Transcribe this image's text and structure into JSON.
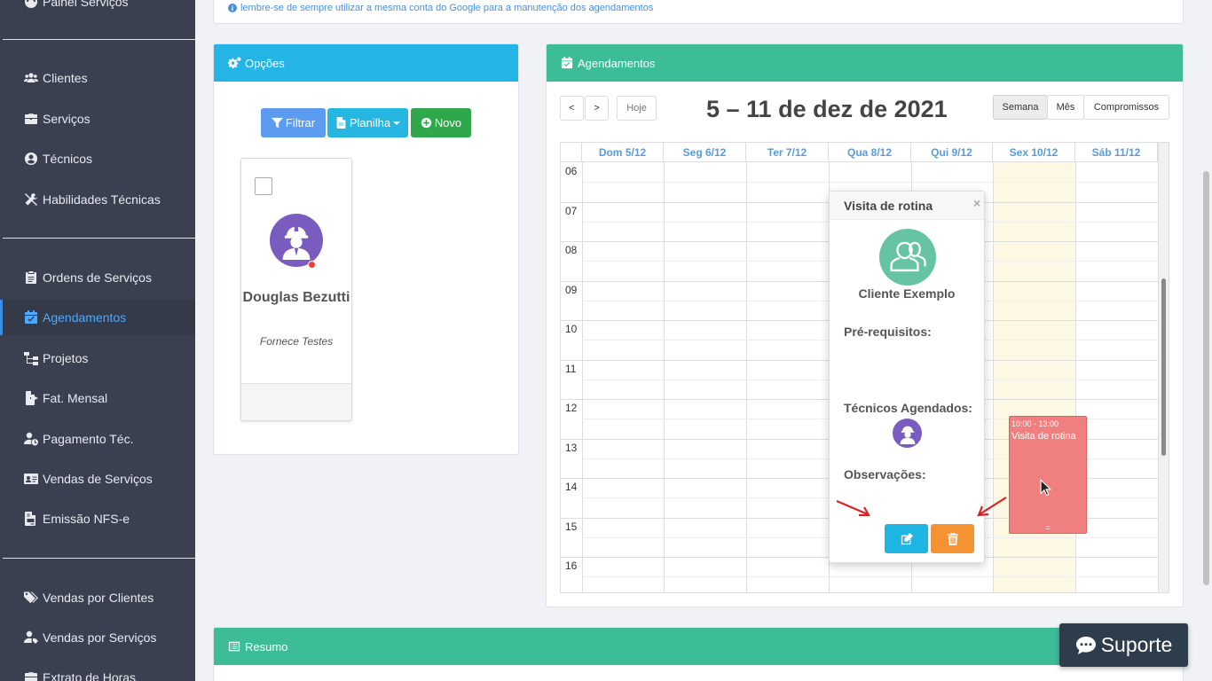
{
  "sidebar": {
    "items": [
      {
        "label": "Painel Serviços",
        "icon": "dashboard-icon"
      },
      {
        "label": "Clientes",
        "icon": "users-icon"
      },
      {
        "label": "Serviços",
        "icon": "briefcase-icon"
      },
      {
        "label": "Técnicos",
        "icon": "user-circle-icon"
      },
      {
        "label": "Habilidades Técnicas",
        "icon": "tools-icon"
      },
      {
        "label": "Ordens de Serviços",
        "icon": "clipboard-icon"
      },
      {
        "label": "Agendamentos",
        "icon": "calendar-check-icon"
      },
      {
        "label": "Projetos",
        "icon": "sitemap-icon"
      },
      {
        "label": "Fat. Mensal",
        "icon": "file-export-icon"
      },
      {
        "label": "Pagamento Téc.",
        "icon": "user-clock-icon"
      },
      {
        "label": "Vendas de Serviços",
        "icon": "id-card-icon"
      },
      {
        "label": "Emissão NFS-e",
        "icon": "file-invoice-icon"
      },
      {
        "label": "Vendas por Clientes",
        "icon": "tags-icon"
      },
      {
        "label": "Vendas por Serviços",
        "icon": "user-tag-icon"
      },
      {
        "label": "Extrato de Horas",
        "icon": "briefcase-clock-icon"
      }
    ],
    "active": "Agendamentos"
  },
  "top_note": "lembre-se de sempre utilizar a mesma conta do Google para a manutenção dos agendamentos",
  "options_panel": {
    "title": "Opções",
    "filter_label": "Filtrar",
    "sheet_label": "Planilha",
    "new_label": "Novo",
    "technician": {
      "name": "Douglas Bezutti",
      "role": "Fornece Testes"
    }
  },
  "schedule_panel": {
    "title": "Agendamentos",
    "prev_label": "<",
    "next_label": ">",
    "today_label": "Hoje",
    "range_title": "5 – 11 de dez de 2021",
    "views": [
      "Semana",
      "Mês",
      "Compromissos"
    ],
    "active_view": "Semana",
    "days": [
      "Dom 5/12",
      "Seg 6/12",
      "Ter 7/12",
      "Qua 8/12",
      "Qui 9/12",
      "Sex 10/12",
      "Sáb 11/12"
    ],
    "hours": [
      "06",
      "07",
      "08",
      "09",
      "10",
      "11",
      "12",
      "13",
      "14",
      "15",
      "16"
    ],
    "event": {
      "time": "10:00 - 13:00",
      "title": "Visita de rotina",
      "grip": "="
    },
    "popover": {
      "title": "Visita de rotina",
      "close": "×",
      "client": "Cliente Exemplo",
      "prereq_label": "Pré-requisitos:",
      "techs_label": "Técnicos Agendados:",
      "notes_label": "Observações:"
    }
  },
  "summary_panel": {
    "title": "Resumo"
  },
  "support_label": "Suporte",
  "colors": {
    "sidebar_bg": "#3a4050",
    "options_header": "#25b4e6",
    "schedule_header": "#3cbd98",
    "filter_btn": "#5b9bf0",
    "sheet_btn": "#26b6e2",
    "new_btn": "#2ea84a",
    "event": "#f08080",
    "edit_btn": "#1fb5e3",
    "delete_btn": "#f59332"
  }
}
